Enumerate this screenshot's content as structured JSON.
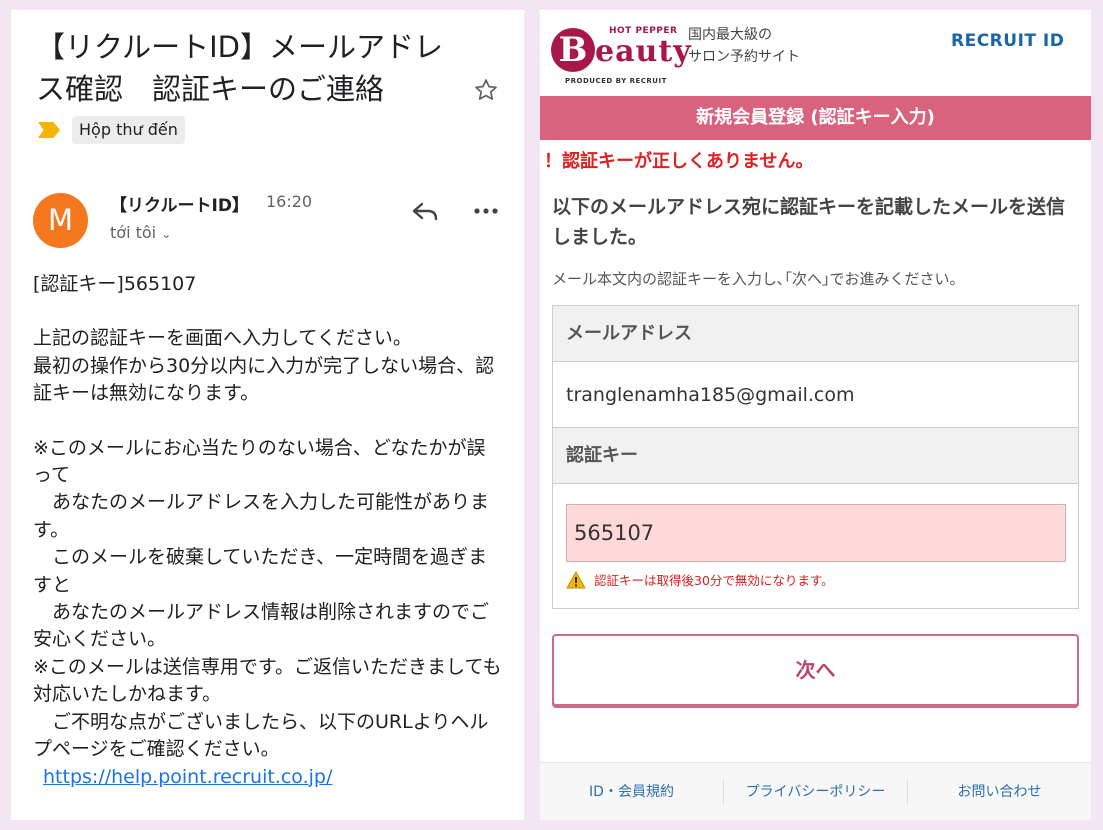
{
  "email": {
    "subject": "【リクルートID】メールアドレス確認　認証キーのご連絡",
    "label": "Hộp thư đến",
    "avatar_letter": "M",
    "avatar_color": "#f5781f",
    "sender": "【リクルートID】",
    "time": "16:20",
    "recipient": "tới tôi",
    "star_icon": "star-outline-icon",
    "reply_icon": "reply-icon",
    "more_icon": "more-horizontal-icon",
    "body": {
      "key_line": "[認証キー]565107",
      "p1": "上記の認証キーを画面へ入力してください。\n最初の操作から30分以内に入力が完了しない場合、認証キーは無効になります。",
      "p2": "※このメールにお心当たりのない場合、どなたかが誤って\n　あなたのメールアドレスを入力した可能性があります。\n　このメールを破棄していただき、一定時間を過ぎますと\n　あなたのメールアドレス情報は削除されますのでご安心ください。\n※このメールは送信専用です。ご返信いただきましても対応いたしかねます。\n　ご不明な点がございましたら、以下のURLよりヘルプページをご確認ください。",
      "link": "https://help.point.recruit.co.jp/"
    }
  },
  "site": {
    "logo": {
      "letter": "B",
      "hot_pepper": "HOT PEPPER",
      "beauty": "eauty",
      "produced_by": "PRODUCED BY RECRUIT"
    },
    "tagline_1": "国内最大級の",
    "tagline_2": "サロン予約サイト",
    "recruit_id": "RECRUIT ID",
    "page_bar": "新規会員登録 (認証キー入力)",
    "error": "！認証キーが正しくありません。",
    "lead": "以下のメールアドレス宛に認証キーを記載したメールを送信しました。",
    "note": "メール本文内の認証キーを入力し､｢次へ｣でお進みください。",
    "form": {
      "email_label": "メールアドレス",
      "email_value": "tranglenamha185@gmail.com",
      "key_label": "認証キー",
      "key_value": "565107",
      "warning": "認証キーは取得後30分で無効になります。"
    },
    "next_button": "次へ",
    "footer": {
      "terms": "ID・会員規約",
      "privacy": "プライバシーポリシー",
      "contact": "お問い合わせ"
    },
    "colors": {
      "brand": "#a8174a",
      "bar": "#d9637f",
      "error": "#e02020",
      "input_bg": "#ffd9d9"
    }
  }
}
